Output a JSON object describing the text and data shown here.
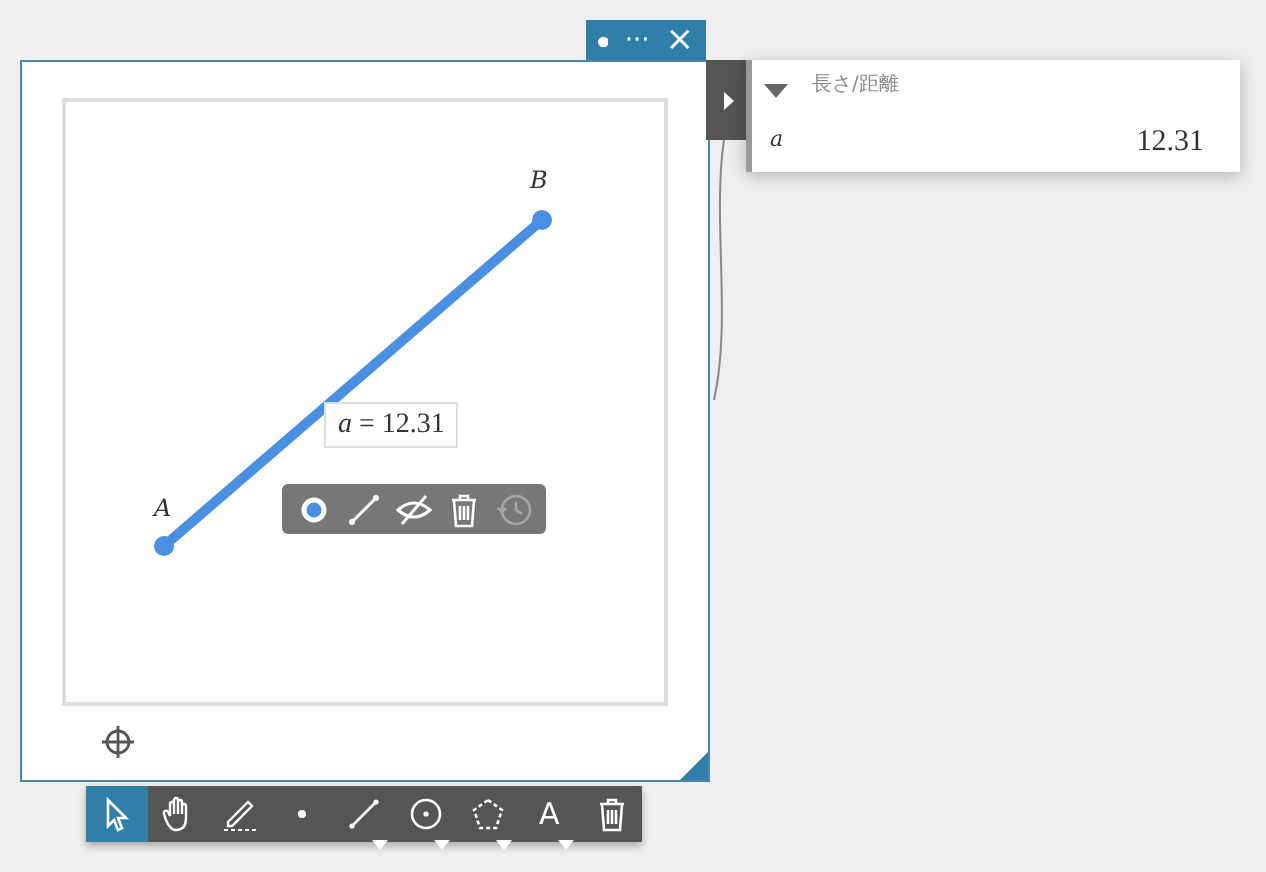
{
  "window": {
    "tab": {
      "more": "···",
      "close": "×"
    }
  },
  "canvas": {
    "points": [
      {
        "label": "A"
      },
      {
        "label": "B"
      }
    ],
    "segment_label": "*a* = 12.31"
  },
  "context_toolbar": [
    {
      "kind": "style",
      "disabled": false
    },
    {
      "kind": "segment",
      "disabled": false
    },
    {
      "kind": "hide",
      "disabled": false
    },
    {
      "kind": "delete",
      "disabled": false
    },
    {
      "kind": "history",
      "disabled": true
    }
  ],
  "toolbar": [
    {
      "kind": "pointer",
      "selected": true,
      "menu": false
    },
    {
      "kind": "hand",
      "selected": false,
      "menu": false
    },
    {
      "kind": "pen",
      "selected": false,
      "menu": false
    },
    {
      "kind": "point",
      "selected": false,
      "menu": false
    },
    {
      "kind": "segment",
      "selected": false,
      "menu": true
    },
    {
      "kind": "circle",
      "selected": false,
      "menu": true
    },
    {
      "kind": "polygon",
      "selected": false,
      "menu": true
    },
    {
      "kind": "text",
      "label": "A",
      "selected": false,
      "menu": true
    },
    {
      "kind": "delete",
      "selected": false,
      "menu": false
    }
  ],
  "results": {
    "header": "長さ/距離",
    "expanded": true,
    "rows": [
      {
        "name": "a",
        "value": "12.31"
      }
    ]
  }
}
